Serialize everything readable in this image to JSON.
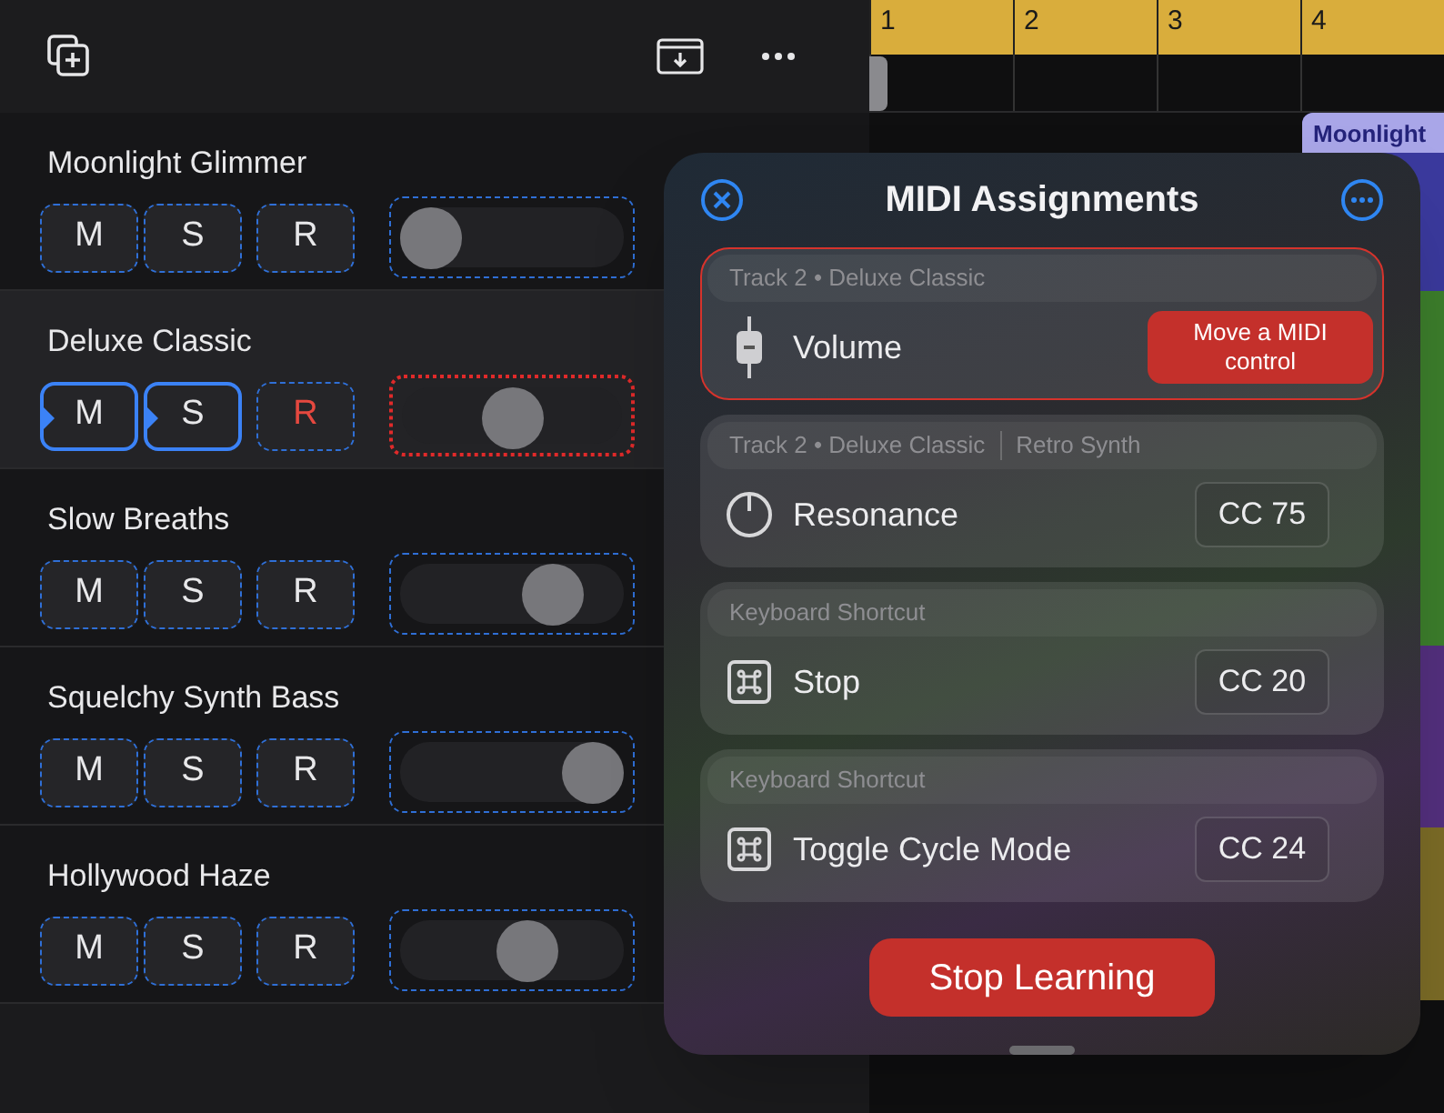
{
  "tracks": [
    {
      "name": "Moonlight Glimmer",
      "selected": false,
      "mute": {
        "label": "M",
        "learned": false
      },
      "solo": {
        "label": "S",
        "learned": false
      },
      "record": {
        "label": "R",
        "armed": false
      },
      "volume": {
        "level": 0.0,
        "learning": false
      }
    },
    {
      "name": "Deluxe Classic",
      "selected": true,
      "mute": {
        "label": "M",
        "learned": true
      },
      "solo": {
        "label": "S",
        "learned": true
      },
      "record": {
        "label": "R",
        "armed": true
      },
      "volume": {
        "level": 0.5,
        "learning": true
      }
    },
    {
      "name": "Slow Breaths",
      "selected": false,
      "mute": {
        "label": "M",
        "learned": false
      },
      "solo": {
        "label": "S",
        "learned": false
      },
      "record": {
        "label": "R",
        "armed": false
      },
      "volume": {
        "level": 0.75,
        "learning": false
      }
    },
    {
      "name": "Squelchy Synth Bass",
      "selected": false,
      "mute": {
        "label": "M",
        "learned": false
      },
      "solo": {
        "label": "S",
        "learned": false
      },
      "record": {
        "label": "R",
        "armed": false
      },
      "volume": {
        "level": 1.0,
        "learning": false
      }
    },
    {
      "name": "Hollywood Haze",
      "selected": false,
      "mute": {
        "label": "M",
        "learned": false
      },
      "solo": {
        "label": "S",
        "learned": false
      },
      "record": {
        "label": "R",
        "armed": false
      },
      "volume": {
        "level": 0.6,
        "learning": false
      }
    }
  ],
  "ruler": {
    "bars": [
      "1",
      "2",
      "3",
      "4"
    ]
  },
  "regions": [
    {
      "label": "Moonlight",
      "color": "#3b3a9e"
    },
    {
      "color": "#3d7f2c"
    },
    {
      "color": "#54307f"
    },
    {
      "color": "#7d6d27"
    }
  ],
  "popover": {
    "title": "MIDI Assignments",
    "assignments": [
      {
        "header": [
          "Track 2 • Deluxe Classic"
        ],
        "kind": "fader",
        "name": "Volume",
        "learning": true,
        "action": "Move a MIDI control"
      },
      {
        "header": [
          "Track 2 • Deluxe Classic",
          "Retro Synth"
        ],
        "kind": "knob",
        "name": "Resonance",
        "learning": false,
        "control": "CC 75"
      },
      {
        "header": [
          "Keyboard Shortcut"
        ],
        "kind": "shortcut",
        "name": "Stop",
        "learning": false,
        "control": "CC 20"
      },
      {
        "header": [
          "Keyboard Shortcut"
        ],
        "kind": "shortcut",
        "name": "Toggle Cycle Mode",
        "learning": false,
        "control": "CC 24"
      }
    ],
    "button": "Stop Learning"
  }
}
